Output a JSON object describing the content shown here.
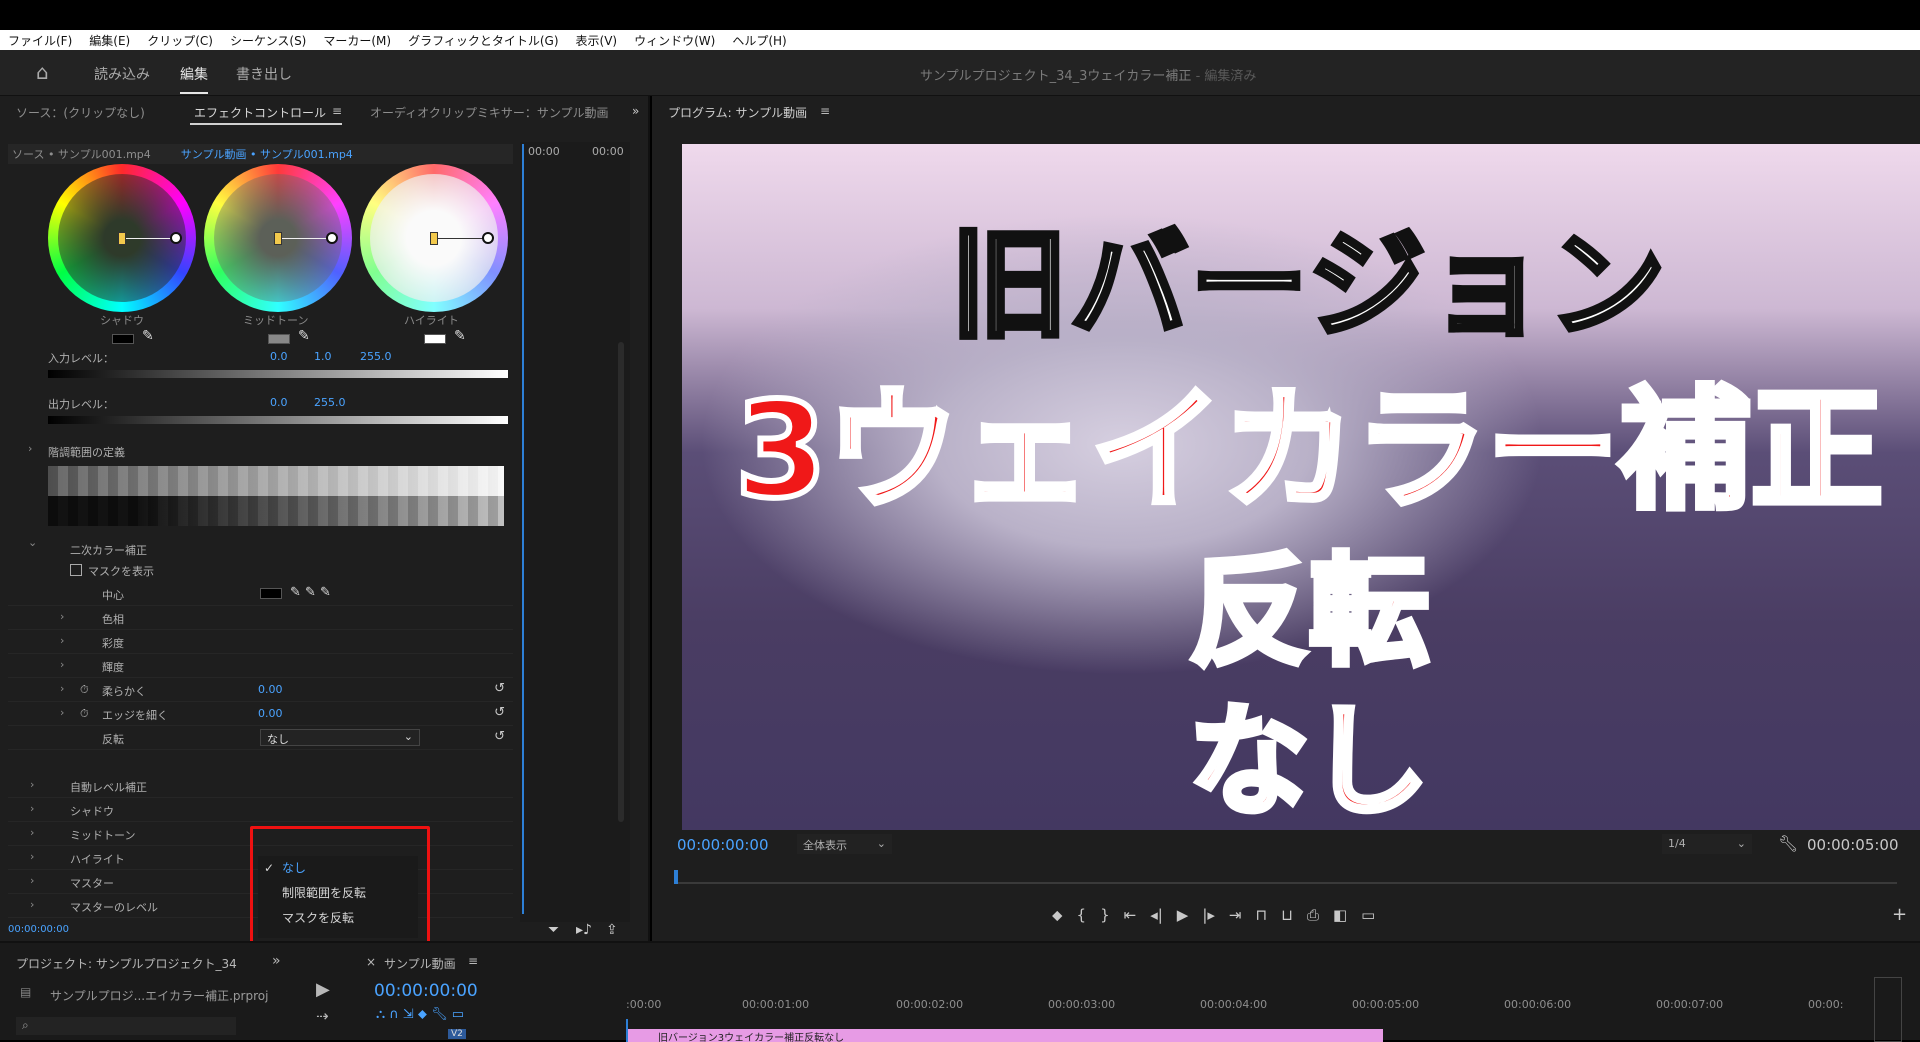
{
  "menu": [
    "ファイル(F)",
    "編集(E)",
    "クリップ(C)",
    "シーケンス(S)",
    "マーカー(M)",
    "グラフィックとタイトル(G)",
    "表示(V)",
    "ウィンドウ(W)",
    "ヘルプ(H)"
  ],
  "header": {
    "tabs": [
      "読み込み",
      "編集",
      "書き出し"
    ],
    "project_title": "サンプルプロジェクト_34_3ウェイカラー補正",
    "project_status": " - 編集済み"
  },
  "left_panel": {
    "tabs": [
      "ソース：(クリップなし)",
      "エフェクトコントロール",
      "オーディオクリップミキサー：サンプル動画"
    ],
    "source_clip": "ソース • サンプル001.mp4",
    "sequence_clip": "サンプル動画 • サンプル001.mp4",
    "timeline_start": "00:00",
    "timeline_end": "00:00",
    "wheels": {
      "shadow": "シャドウ",
      "midtone": "ミッドトーン",
      "highlight": "ハイライト"
    },
    "input_level_label": "入力レベル：",
    "input_values": [
      "0.0",
      "1.0",
      "255.0"
    ],
    "output_level_label": "出力レベル：",
    "output_values": [
      "0.0",
      "255.0"
    ],
    "tonal_range": "階調範囲の定義",
    "secondary": "二次カラー補正",
    "show_mask": "マスクを表示",
    "center": "中心",
    "hue": "色相",
    "saturation": "彩度",
    "luminance": "輝度",
    "soften": "柔らかく",
    "soften_value": "0.00",
    "edge_thin": "エッジを細く",
    "edge_value": "0.00",
    "invert": "反転",
    "invert_value": "なし",
    "auto_level": "自動レベル補正",
    "shadow": "シャドウ",
    "midtone": "ミッドトーン",
    "highlight": "ハイライト",
    "master": "マスター",
    "master_level": "マスターのレベル",
    "timecode": "00:00:00:00",
    "invert_options": [
      "なし",
      "制限範囲を反転",
      "マスクを反転"
    ]
  },
  "program": {
    "title": "プログラム: サンプル動画",
    "captions": [
      "旧バージョン",
      "3ウェイカラー補正",
      "反転",
      "なし"
    ],
    "timecode": "00:00:00:00",
    "fit": "全体表示",
    "resolution": "1/4",
    "duration": "00:00:05:00"
  },
  "bottom": {
    "project_tab": "プロジェクト: サンプルプロジェクト_34",
    "project_file": "サンプルプロジ...エイカラー補正.prproj",
    "sequence_tab": "サンプル動画",
    "timecode": "00:00:00:00",
    "ticks": [
      ":00:00",
      "00:00:01:00",
      "00:00:02:00",
      "00:00:03:00",
      "00:00:04:00",
      "00:00:05:00",
      "00:00:06:00",
      "00:00:07:00",
      "00:00:"
    ],
    "clip_label": "旧バージョン3ウェイカラー補正反転なし",
    "track": "V2"
  },
  "colors": {
    "accent": "#4aa3ff",
    "highlight_box": "#e11111",
    "caption_red": "#f01818",
    "clip": "#e79be5"
  }
}
